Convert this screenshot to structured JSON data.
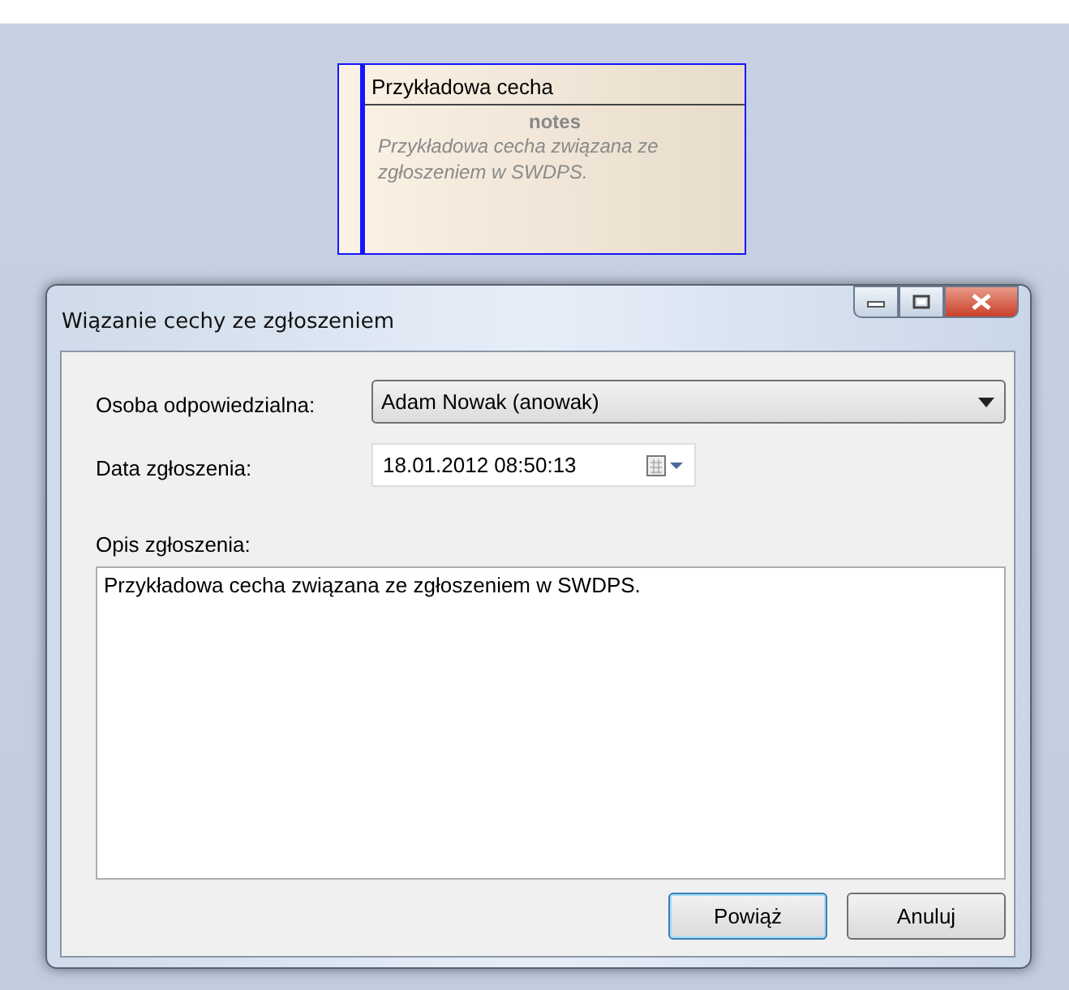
{
  "diagram_element": {
    "title": "Przykładowa cecha",
    "section": "notes",
    "notes": "Przykładowa cecha związana ze zgłoszeniem w SWDPS.",
    "selected": true
  },
  "dialog": {
    "title": "Wiązanie cechy ze zgłoszeniem",
    "fields": [
      {
        "kind": "combo",
        "label": "Osoba odpowiedzialna:",
        "value": "Adam Nowak (anowak)"
      },
      {
        "kind": "date",
        "label": "Data zgłoszenia:",
        "value": "18.01.2012 08:50:13"
      }
    ],
    "description": {
      "label": "Opis zgłoszenia:",
      "value": "Przykładowa cecha związana ze zgłoszeniem w SWDPS."
    },
    "buttons": [
      {
        "label": "Powiąż",
        "default": true
      },
      {
        "label": "Anuluj",
        "default": false
      }
    ]
  }
}
